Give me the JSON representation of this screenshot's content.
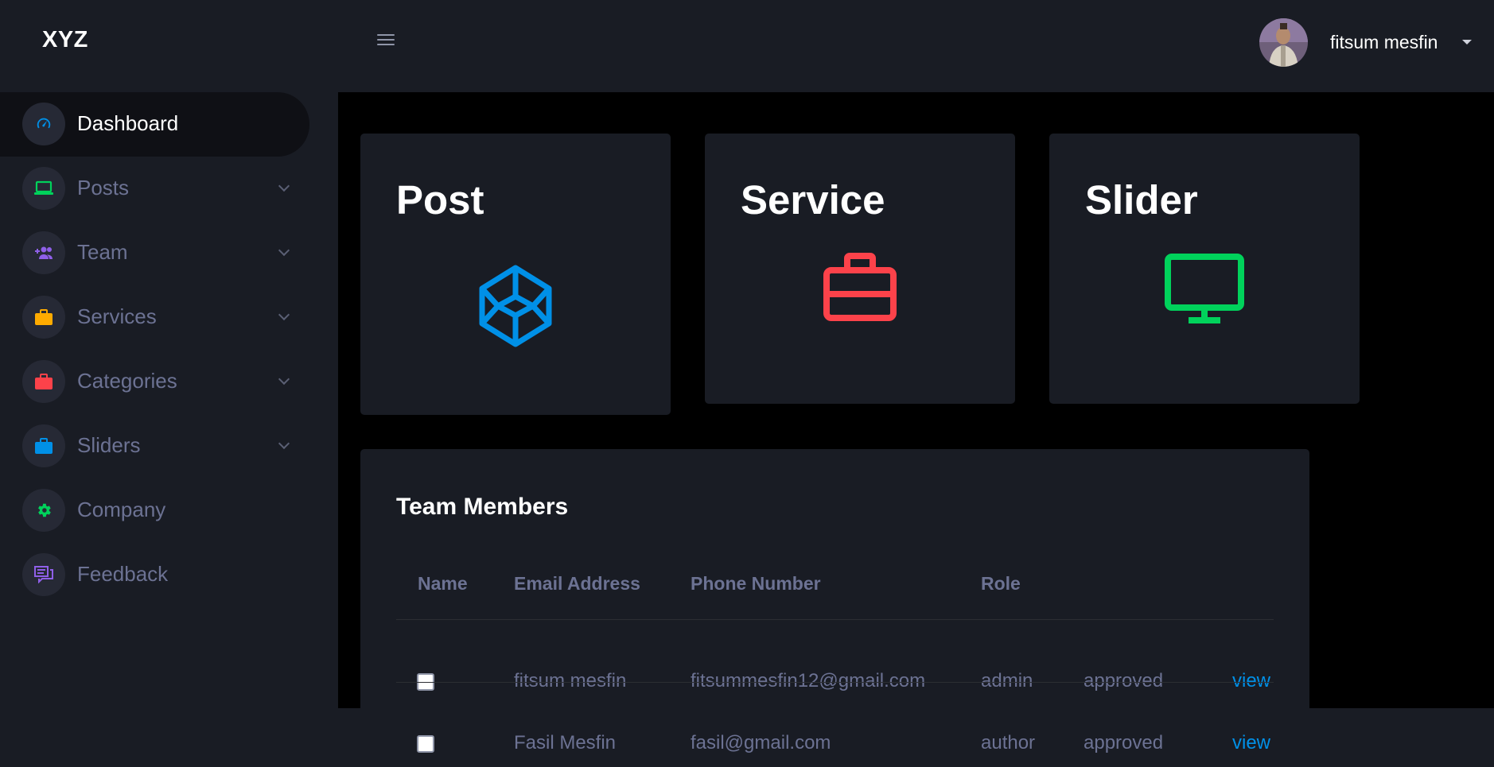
{
  "brand": "XYZ",
  "header": {
    "profile_name": "fitsum mesfin"
  },
  "sidebar": {
    "items": [
      {
        "label": "Dashboard",
        "icon": "speedometer-icon",
        "color": "#0090e7",
        "active": true
      },
      {
        "label": "Posts",
        "icon": "laptop-icon",
        "color": "#00d25b"
      },
      {
        "label": "Team",
        "icon": "users-add-icon",
        "color": "#8f5fe8"
      },
      {
        "label": "Services",
        "icon": "briefcase-icon",
        "color": "#ffab00"
      },
      {
        "label": "Categories",
        "icon": "briefcase-icon",
        "color": "#fc424a"
      },
      {
        "label": "Sliders",
        "icon": "briefcase-icon",
        "color": "#0090e7"
      },
      {
        "label": "Company",
        "icon": "gear-icon",
        "color": "#00d25b"
      },
      {
        "label": "Feedback",
        "icon": "chat-icon",
        "color": "#8f5fe8"
      }
    ]
  },
  "cards": [
    {
      "title": "Post",
      "icon": "codepen-icon",
      "color": "#0090e7"
    },
    {
      "title": "Service",
      "icon": "briefcase-icon",
      "color": "#fc424a"
    },
    {
      "title": "Slider",
      "icon": "monitor-icon",
      "color": "#00d25b"
    }
  ],
  "team_table": {
    "title": "Team Members",
    "headers": [
      "Name",
      "Email Address",
      "Phone Number",
      "Role"
    ],
    "rows": [
      {
        "name": "fitsum mesfin",
        "email": "fitsummesfin12@gmail.com",
        "role": "admin",
        "status": "approved",
        "action": "view"
      },
      {
        "name": "Fasil Mesfin",
        "email": "fasil@gmail.com",
        "role": "author",
        "status": "approved",
        "action": "view"
      }
    ]
  },
  "colors": {
    "panel": "#191c24",
    "background": "#000000",
    "muted_text": "#6c7293",
    "link": "#0090e7"
  }
}
